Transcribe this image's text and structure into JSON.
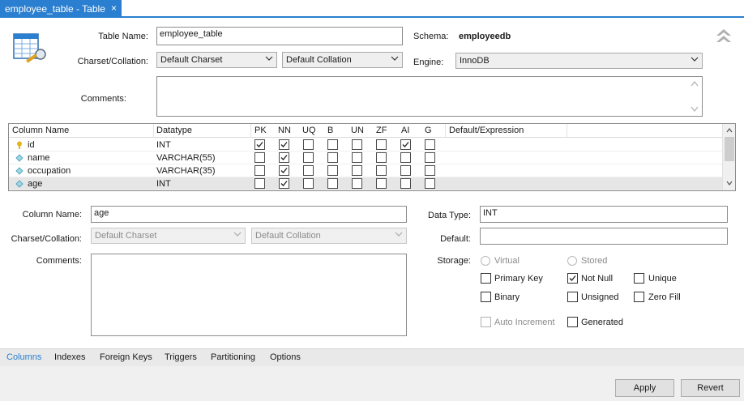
{
  "tab": {
    "title": "employee_table - Table",
    "close": "×"
  },
  "form": {
    "table_name_label": "Table Name:",
    "table_name_value": "employee_table",
    "schema_label": "Schema:",
    "schema_value": "employeedb",
    "charset_label": "Charset/Collation:",
    "charset_value": "Default Charset",
    "collation_value": "Default Collation",
    "engine_label": "Engine:",
    "engine_value": "InnoDB",
    "comments_label": "Comments:",
    "comments_value": ""
  },
  "grid": {
    "headers": [
      "Column Name",
      "Datatype",
      "PK",
      "NN",
      "UQ",
      "B",
      "UN",
      "ZF",
      "AI",
      "G",
      "Default/Expression"
    ],
    "rows": [
      {
        "name": "id",
        "datatype": "INT",
        "icon": "key-icon",
        "flags": [
          true,
          true,
          false,
          false,
          false,
          false,
          true,
          false
        ]
      },
      {
        "name": "name",
        "datatype": "VARCHAR(55)",
        "icon": "diamond-icon",
        "flags": [
          false,
          true,
          false,
          false,
          false,
          false,
          false,
          false
        ]
      },
      {
        "name": "occupation",
        "datatype": "VARCHAR(35)",
        "icon": "diamond-icon",
        "flags": [
          false,
          true,
          false,
          false,
          false,
          false,
          false,
          false
        ]
      },
      {
        "name": "age",
        "datatype": "INT",
        "icon": "diamond-icon",
        "flags": [
          false,
          true,
          false,
          false,
          false,
          false,
          false,
          false
        ]
      }
    ]
  },
  "detail": {
    "column_name_label": "Column Name:",
    "column_name_value": "age",
    "charset_label": "Charset/Collation:",
    "charset_value": "Default Charset",
    "collation_value": "Default Collation",
    "comments_label": "Comments:",
    "data_type_label": "Data Type:",
    "data_type_value": "INT",
    "default_label": "Default:",
    "default_value": "",
    "storage_label": "Storage:",
    "virtual_label": "Virtual",
    "stored_label": "Stored",
    "primary_key_label": "Primary Key",
    "not_null_label": "Not Null",
    "unique_label": "Unique",
    "binary_label": "Binary",
    "unsigned_label": "Unsigned",
    "zero_fill_label": "Zero Fill",
    "auto_increment_label": "Auto Increment",
    "generated_label": "Generated"
  },
  "bottom_tabs": [
    "Columns",
    "Indexes",
    "Foreign Keys",
    "Triggers",
    "Partitioning",
    "Options"
  ],
  "buttons": {
    "apply": "Apply",
    "revert": "Revert"
  },
  "colors": {
    "accent": "#2a7fd0"
  }
}
